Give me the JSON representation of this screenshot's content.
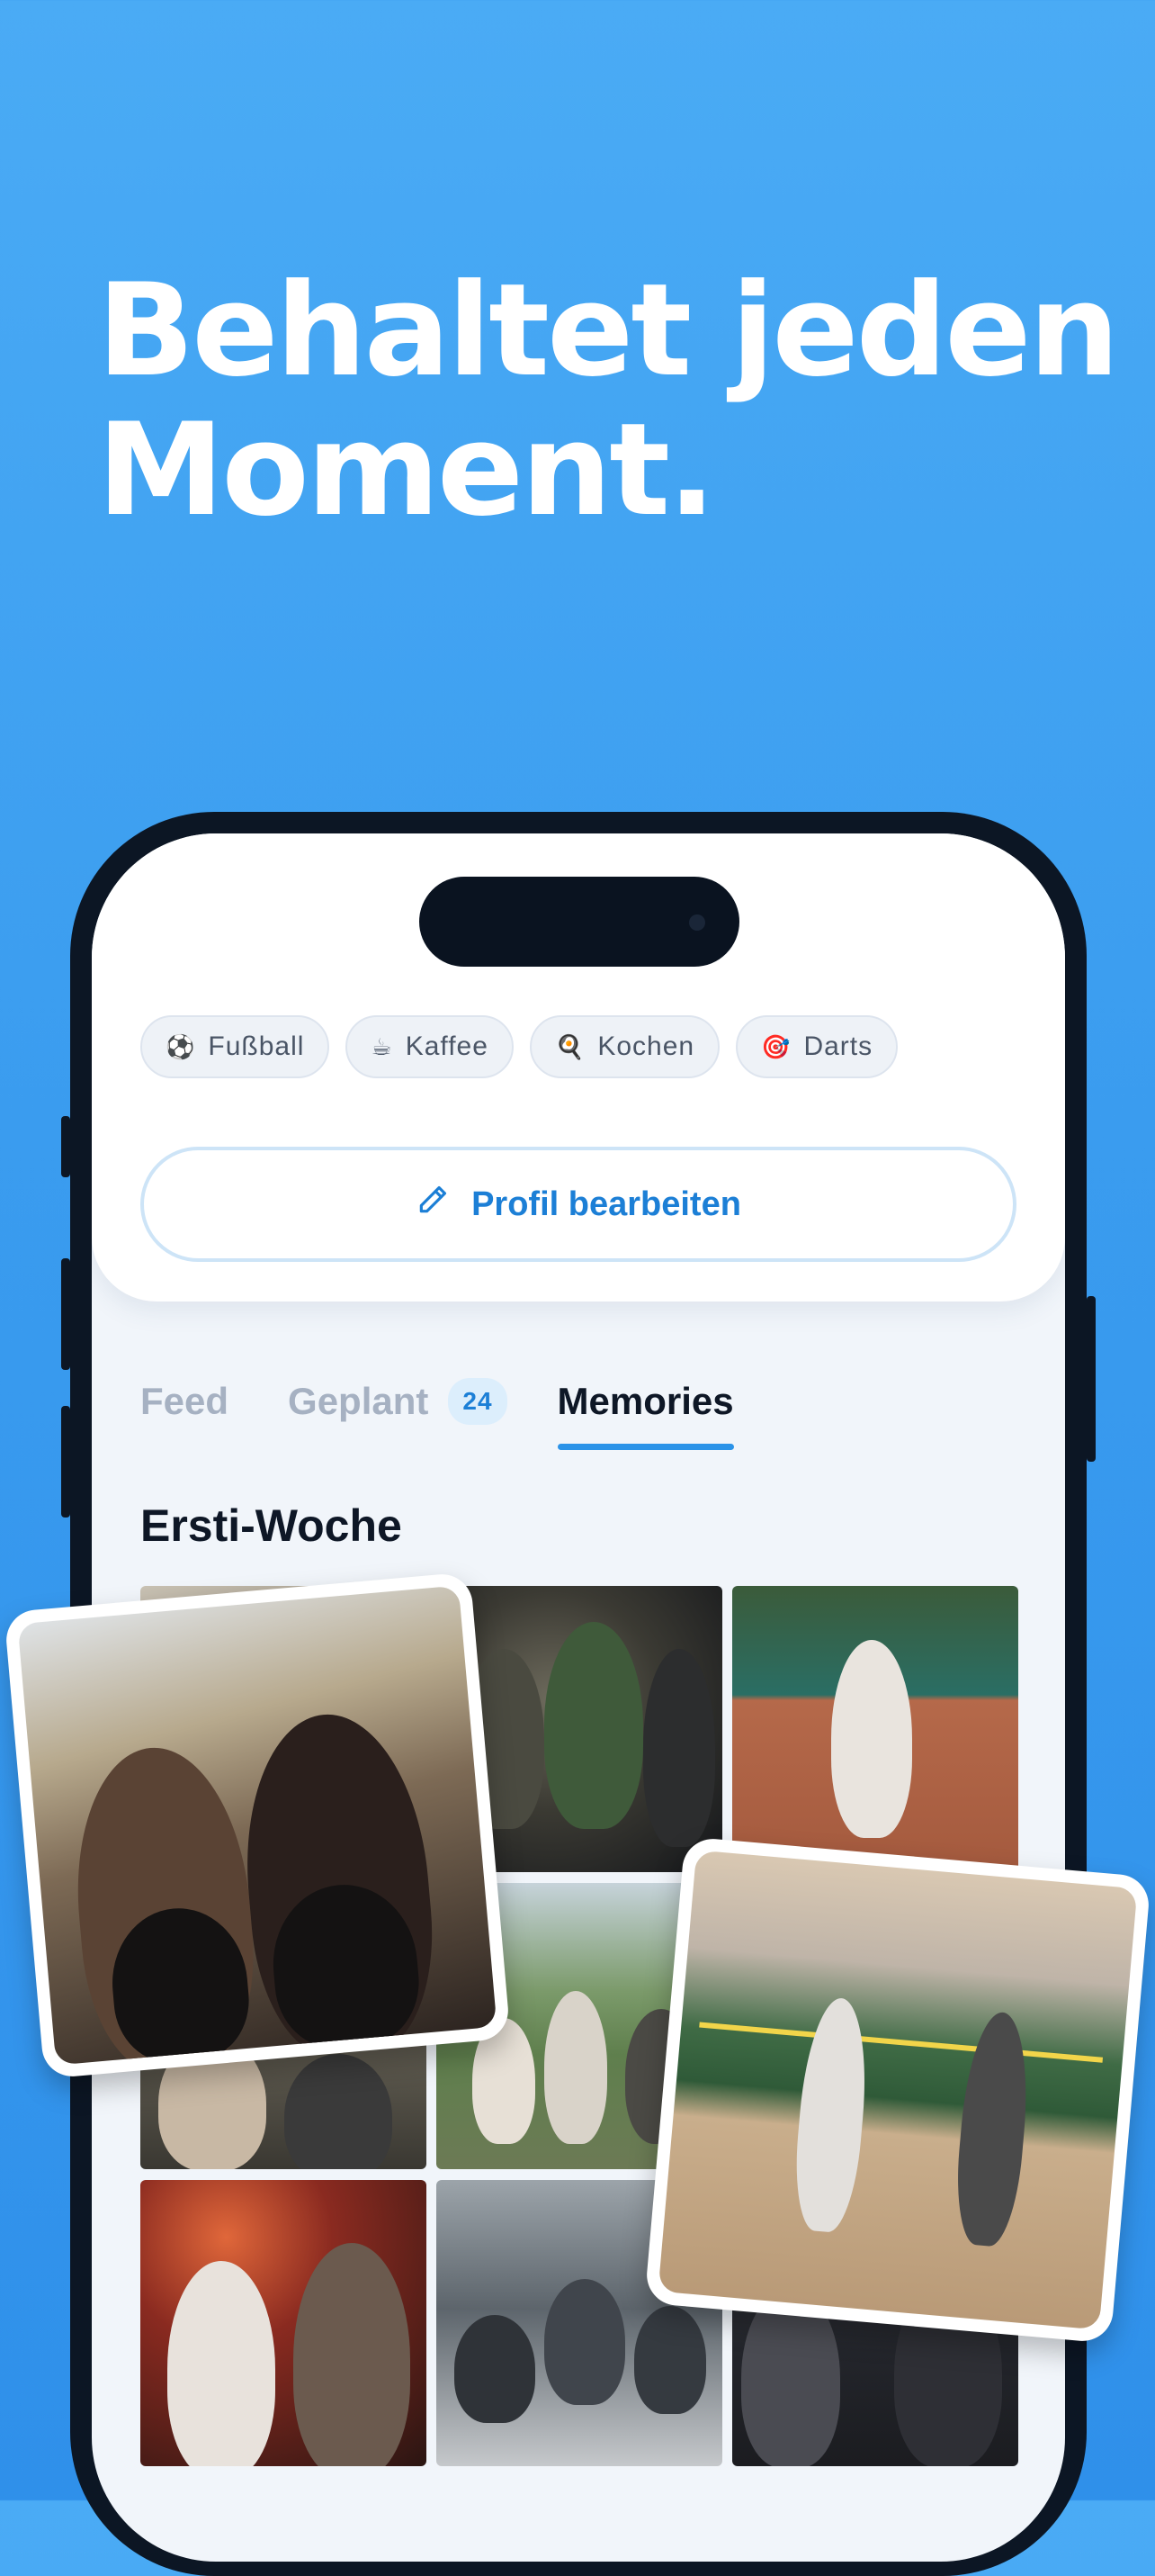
{
  "headline": {
    "line1": "Behaltet jeden",
    "line2": "Moment."
  },
  "profile": {
    "interests": [
      {
        "icon": "soccer-ball-icon",
        "glyph": "⚽",
        "label": "Fußball"
      },
      {
        "icon": "coffee-icon",
        "glyph": "☕",
        "label": "Kaffee"
      },
      {
        "icon": "frying-pan-icon",
        "glyph": "🍳",
        "label": "Kochen"
      },
      {
        "icon": "dart-target-icon",
        "glyph": "🎯",
        "label": "Darts"
      }
    ],
    "edit_button_label": "Profil bearbeiten"
  },
  "tabs": {
    "feed": "Feed",
    "geplant": "Geplant",
    "geplant_count": "24",
    "memories": "Memories",
    "active": "memories"
  },
  "memories": {
    "section_title": "Ersti-Woche",
    "photos": [
      {
        "name": "photo-festival-crowd"
      },
      {
        "name": "photo-night-group-sitting"
      },
      {
        "name": "photo-tennis-player"
      },
      {
        "name": "photo-picnic-group"
      },
      {
        "name": "photo-park-group"
      },
      {
        "name": "photo-beach-volleyball"
      },
      {
        "name": "photo-bar-friends"
      },
      {
        "name": "photo-study-room"
      },
      {
        "name": "photo-dinner-table"
      }
    ]
  },
  "colors": {
    "background": "#3a9cef",
    "accent": "#1c7fd6",
    "tab_underline": "#2b93e8",
    "badge_bg": "#dceefc"
  }
}
